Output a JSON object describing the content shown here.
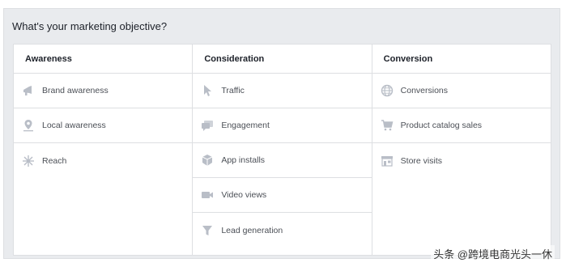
{
  "title": "What's your marketing objective?",
  "columns": [
    {
      "header": "Awareness",
      "items": [
        {
          "label": "Brand awareness",
          "icon": "megaphone-icon"
        },
        {
          "label": "Local awareness",
          "icon": "location-pin-icon"
        },
        {
          "label": "Reach",
          "icon": "reach-asterisk-icon"
        }
      ]
    },
    {
      "header": "Consideration",
      "items": [
        {
          "label": "Traffic",
          "icon": "cursor-icon"
        },
        {
          "label": "Engagement",
          "icon": "chat-bubbles-icon"
        },
        {
          "label": "App installs",
          "icon": "box-icon"
        },
        {
          "label": "Video views",
          "icon": "video-camera-icon"
        },
        {
          "label": "Lead generation",
          "icon": "funnel-icon"
        }
      ]
    },
    {
      "header": "Conversion",
      "items": [
        {
          "label": "Conversions",
          "icon": "globe-icon"
        },
        {
          "label": "Product catalog sales",
          "icon": "shopping-cart-icon"
        },
        {
          "label": "Store visits",
          "icon": "store-icon"
        }
      ]
    }
  ],
  "watermark": "头条 @跨境电商光头一休",
  "colors": {
    "icon": "#b9bec7",
    "border": "#dddfe2",
    "panel": "#e9ebee"
  }
}
